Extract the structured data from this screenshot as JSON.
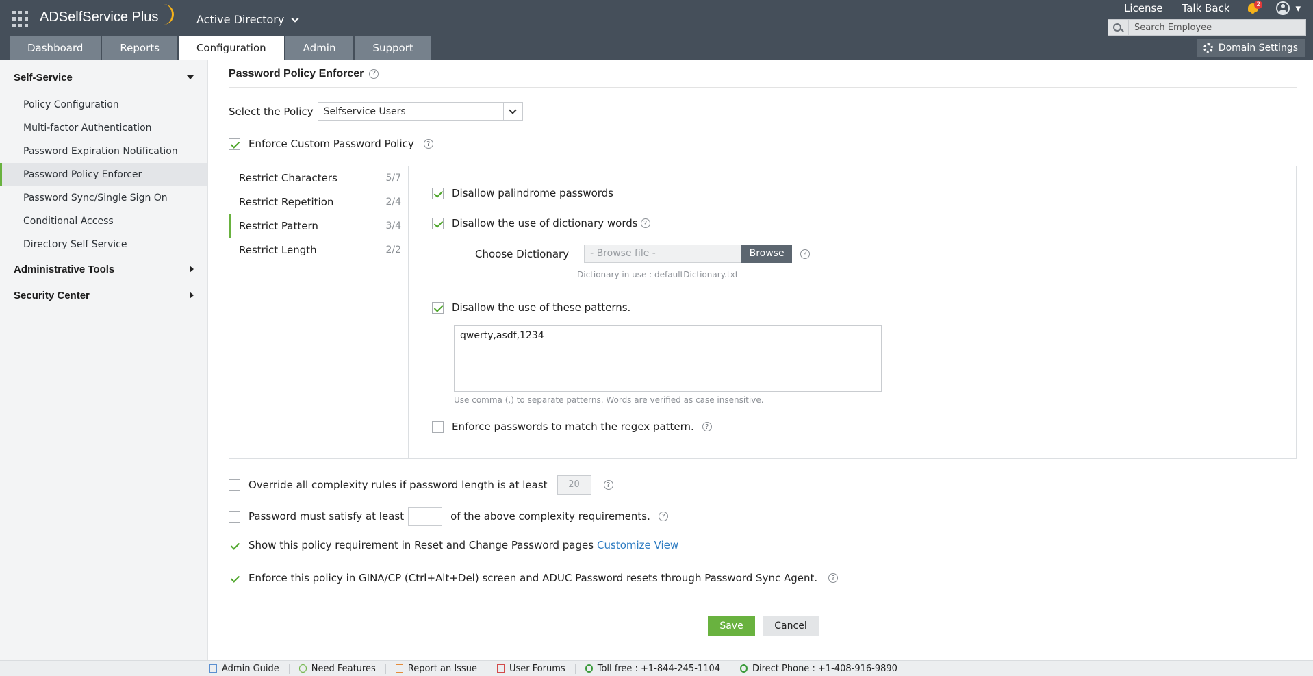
{
  "header": {
    "brand": "ADSelfService Plus",
    "domain_selector": "Active Directory",
    "links": {
      "license": "License",
      "talk_back": "Talk Back"
    },
    "notification_count": "2",
    "search_placeholder": "Search Employee",
    "domain_settings": "Domain Settings",
    "tabs": [
      "Dashboard",
      "Reports",
      "Configuration",
      "Admin",
      "Support"
    ]
  },
  "sidebar": {
    "self_service": "Self-Service",
    "items": [
      "Policy Configuration",
      "Multi-factor Authentication",
      "Password Expiration Notification",
      "Password Policy Enforcer",
      "Password Sync/Single Sign On",
      "Conditional Access",
      "Directory Self Service"
    ],
    "admin_tools": "Administrative Tools",
    "security_center": "Security Center"
  },
  "main": {
    "title": "Password Policy Enforcer",
    "select_policy_label": "Select the Policy",
    "select_policy_value": "Selfservice Users",
    "enforce_custom": "Enforce Custom Password Policy",
    "subnav": [
      {
        "label": "Restrict Characters",
        "count": "5/7"
      },
      {
        "label": "Restrict Repetition",
        "count": "2/4"
      },
      {
        "label": "Restrict Pattern",
        "count": "3/4"
      },
      {
        "label": "Restrict Length",
        "count": "2/2"
      }
    ],
    "pattern": {
      "palindrome": "Disallow palindrome passwords",
      "dictionary": "Disallow the use of dictionary words",
      "choose_dictionary": "Choose Dictionary",
      "browse_placeholder": "- Browse file -",
      "browse_button": "Browse",
      "dictionary_in_use": "Dictionary in use : defaultDictionary.txt",
      "disallow_patterns": "Disallow the use of these patterns.",
      "patterns_value": "qwerty,asdf,1234",
      "patterns_hint": "Use comma (,) to separate patterns. Words are verified as case insensitive.",
      "regex": "Enforce passwords to match the regex pattern."
    },
    "override_label": "Override all complexity rules if password length is at least",
    "override_value": "20",
    "satisfy_label_before": "Password must satisfy at least",
    "satisfy_label_after": "of the above complexity requirements.",
    "show_policy_label": "Show this policy requirement in Reset and Change Password pages",
    "customize_view": "Customize View",
    "gina_label": "Enforce this policy in GINA/CP (Ctrl+Alt+Del) screen and ADUC Password resets through Password Sync Agent.",
    "save": "Save",
    "cancel": "Cancel"
  },
  "footer": {
    "admin_guide": "Admin Guide",
    "need_features": "Need Features",
    "report_issue": "Report an Issue",
    "user_forums": "User Forums",
    "toll_free": "Toll free : +1-844-245-1104",
    "direct_phone": "Direct Phone : +1-408-916-9890"
  }
}
